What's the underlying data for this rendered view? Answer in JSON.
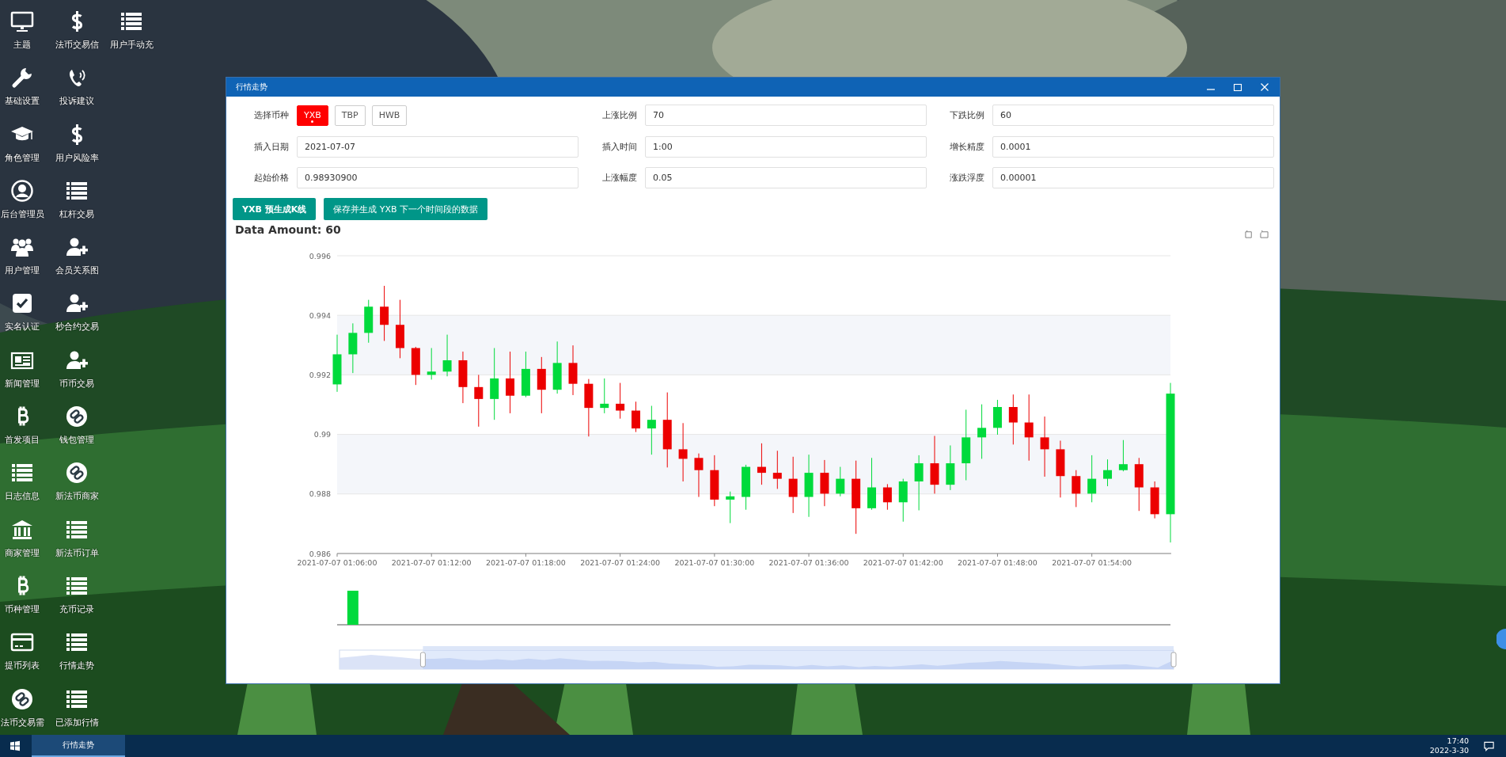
{
  "desktop": {
    "columns": [
      [
        {
          "label": "主题",
          "kind": "monitor"
        },
        {
          "label": "基础设置",
          "kind": "wrench"
        },
        {
          "label": "角色管理",
          "kind": "cap"
        },
        {
          "label": "后台管理员",
          "kind": "usercircle"
        },
        {
          "label": "用户管理",
          "kind": "users"
        },
        {
          "label": "实名认证",
          "kind": "check"
        },
        {
          "label": "新闻管理",
          "kind": "news"
        },
        {
          "label": "首发项目",
          "kind": "bitcoin"
        },
        {
          "label": "日志信息",
          "kind": "list"
        },
        {
          "label": "商家管理",
          "kind": "bank"
        },
        {
          "label": "币种管理",
          "kind": "bitcoin"
        },
        {
          "label": "提币列表",
          "kind": "card"
        },
        {
          "label": "法币交易需",
          "kind": "link"
        }
      ],
      [
        {
          "label": "法币交易信",
          "kind": "dollar"
        },
        {
          "label": "投诉建议",
          "kind": "phone"
        },
        {
          "label": "用户风险率",
          "kind": "dollar"
        },
        {
          "label": "杠杆交易",
          "kind": "list"
        },
        {
          "label": "会员关系图",
          "kind": "userplus"
        },
        {
          "label": "秒合约交易",
          "kind": "userplus"
        },
        {
          "label": "币币交易",
          "kind": "userplus"
        },
        {
          "label": "钱包管理",
          "kind": "link"
        },
        {
          "label": "新法币商家",
          "kind": "link"
        },
        {
          "label": "新法币订单",
          "kind": "list"
        },
        {
          "label": "充币记录",
          "kind": "list"
        },
        {
          "label": "行情走势",
          "kind": "list"
        },
        {
          "label": "已添加行情",
          "kind": "list"
        }
      ],
      [
        {
          "label": "用户手动充",
          "kind": "list"
        }
      ]
    ]
  },
  "window": {
    "title": "行情走势",
    "form": {
      "fields": [
        {
          "kind": "options",
          "label": "选择币种",
          "options": [
            {
              "label": "YXB",
              "selected": true
            },
            {
              "label": "TBP",
              "selected": false
            },
            {
              "label": "HWB",
              "selected": false
            }
          ]
        },
        {
          "kind": "input",
          "label": "上涨比例",
          "value": "70"
        },
        {
          "kind": "input",
          "label": "下跌比例",
          "value": "60"
        },
        {
          "kind": "input",
          "label": "插入日期",
          "value": "2021-07-07"
        },
        {
          "kind": "input",
          "label": "插入时间",
          "value": "1:00"
        },
        {
          "kind": "input",
          "label": "增长精度",
          "value": "0.0001"
        },
        {
          "kind": "input",
          "label": "起始价格",
          "value": "0.98930900"
        },
        {
          "kind": "input",
          "label": "上涨幅度",
          "value": "0.05"
        },
        {
          "kind": "input",
          "label": "涨跌浮度",
          "value": "0.00001"
        }
      ]
    },
    "buttons": [
      "YXB 预生成K线",
      "保存并生成 YXB 下一个时间段的数据"
    ],
    "data_amount": "Data Amount: 60",
    "range_slider": {
      "level": 0.9
    },
    "chart_data": {
      "type": "candlestick",
      "grid": true,
      "ylim": [
        0.986,
        0.996
      ],
      "yticks": [
        0.986,
        0.988,
        0.99,
        0.992,
        0.994,
        0.996
      ],
      "categories": [
        "2021-07-07 01:06:00",
        null,
        null,
        null,
        null,
        null,
        "2021-07-07 01:12:00",
        null,
        null,
        null,
        null,
        null,
        "2021-07-07 01:18:00",
        null,
        null,
        null,
        null,
        null,
        "2021-07-07 01:24:00",
        null,
        null,
        null,
        null,
        null,
        "2021-07-07 01:30:00",
        null,
        null,
        null,
        null,
        null,
        "2021-07-07 01:36:00",
        null,
        null,
        null,
        null,
        null,
        "2021-07-07 01:42:00",
        null,
        null,
        null,
        null,
        null,
        "2021-07-07 01:48:00",
        null,
        null,
        null,
        null,
        null,
        "2021-07-07 01:54:00",
        null,
        null,
        null,
        null,
        null
      ],
      "ohlc": [
        [
          0.99168,
          0.99335,
          0.99143,
          0.99269
        ],
        [
          0.99269,
          0.99373,
          0.99206,
          0.99341
        ],
        [
          0.99341,
          0.99452,
          0.99308,
          0.99429
        ],
        [
          0.99429,
          0.99499,
          0.99314,
          0.99368
        ],
        [
          0.99368,
          0.99452,
          0.99256,
          0.9929
        ],
        [
          0.9929,
          0.99294,
          0.99166,
          0.992
        ],
        [
          0.992,
          0.9929,
          0.99184,
          0.99211
        ],
        [
          0.99211,
          0.99335,
          0.99195,
          0.99249
        ],
        [
          0.99249,
          0.99278,
          0.99105,
          0.99159
        ],
        [
          0.99159,
          0.992,
          0.99026,
          0.99119
        ],
        [
          0.99119,
          0.9929,
          0.99049,
          0.99188
        ],
        [
          0.99188,
          0.99278,
          0.99071,
          0.9913
        ],
        [
          0.9913,
          0.99278,
          0.99125,
          0.9922
        ],
        [
          0.9922,
          0.9926,
          0.99071,
          0.9915
        ],
        [
          0.9915,
          0.99312,
          0.99137,
          0.9924
        ],
        [
          0.9924,
          0.99299,
          0.99132,
          0.9917
        ],
        [
          0.9917,
          0.99186,
          0.98993,
          0.99089
        ],
        [
          0.99089,
          0.99188,
          0.99071,
          0.99103
        ],
        [
          0.99103,
          0.99173,
          0.99053,
          0.9908
        ],
        [
          0.9908,
          0.9911,
          0.99008,
          0.9902
        ],
        [
          0.9902,
          0.99096,
          0.98932,
          0.99049
        ],
        [
          0.99049,
          0.99141,
          0.98889,
          0.9895
        ],
        [
          0.9895,
          0.99038,
          0.98842,
          0.98918
        ],
        [
          0.98921,
          0.98936,
          0.9879,
          0.9888
        ],
        [
          0.9888,
          0.9893,
          0.98759,
          0.98781
        ],
        [
          0.98781,
          0.98808,
          0.98702,
          0.98792
        ],
        [
          0.9879,
          0.98898,
          0.98747,
          0.98891
        ],
        [
          0.98891,
          0.9897,
          0.98831,
          0.98871
        ],
        [
          0.98871,
          0.98945,
          0.98817,
          0.98851
        ],
        [
          0.98851,
          0.98925,
          0.98736,
          0.9879
        ],
        [
          0.9879,
          0.98932,
          0.98723,
          0.98871
        ],
        [
          0.98871,
          0.98914,
          0.98759,
          0.98801
        ],
        [
          0.98801,
          0.98891,
          0.98792,
          0.98851
        ],
        [
          0.98851,
          0.98912,
          0.98666,
          0.98752
        ],
        [
          0.98752,
          0.98921,
          0.98747,
          0.98822
        ],
        [
          0.98822,
          0.98833,
          0.98747,
          0.98772
        ],
        [
          0.98772,
          0.98851,
          0.98707,
          0.98842
        ],
        [
          0.98842,
          0.9893,
          0.98745,
          0.98903
        ],
        [
          0.98903,
          0.98995,
          0.98801,
          0.98831
        ],
        [
          0.98831,
          0.98963,
          0.98813,
          0.98903
        ],
        [
          0.98903,
          0.99083,
          0.98846,
          0.9899
        ],
        [
          0.9899,
          0.99101,
          0.98918,
          0.99022
        ],
        [
          0.99022,
          0.99116,
          0.98999,
          0.99092
        ],
        [
          0.99092,
          0.99134,
          0.98966,
          0.9904
        ],
        [
          0.9904,
          0.99134,
          0.98912,
          0.9899
        ],
        [
          0.9899,
          0.9906,
          0.98858,
          0.9895
        ],
        [
          0.9895,
          0.98979,
          0.98788,
          0.9886
        ],
        [
          0.9886,
          0.9888,
          0.98756,
          0.98801
        ],
        [
          0.98801,
          0.9893,
          0.98772,
          0.98851
        ],
        [
          0.98851,
          0.98916,
          0.98826,
          0.9888
        ],
        [
          0.9888,
          0.98981,
          0.98876,
          0.989
        ],
        [
          0.989,
          0.98921,
          0.98743,
          0.98822
        ],
        [
          0.98822,
          0.98842,
          0.98718,
          0.98732
        ],
        [
          0.98732,
          0.99173,
          0.98637,
          0.99137
        ]
      ]
    }
  },
  "taskbar": {
    "tasks": [
      {
        "label": "行情走势",
        "selected": true
      }
    ],
    "time": "17:40",
    "date": "2022-3-30"
  }
}
